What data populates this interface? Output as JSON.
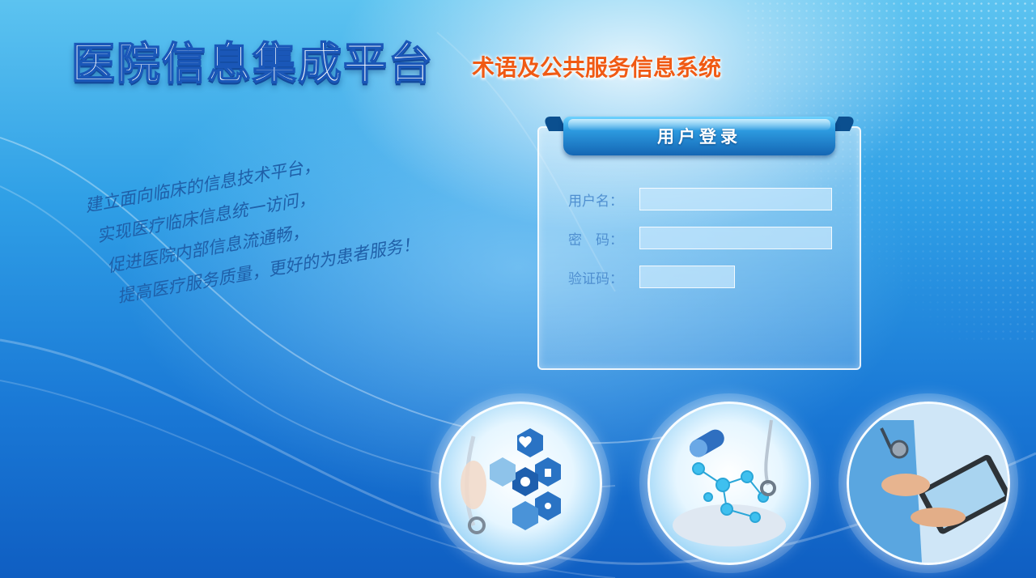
{
  "header": {
    "main_title": "医院信息集成平台",
    "sub_title": "术语及公共服务信息系统"
  },
  "slogan": {
    "lines": [
      "建立面向临床的信息技术平台，",
      "实现医疗临床信息统一访问，",
      "促进医院内部信息流通畅，",
      "提高医疗服务质量，更好的为患者服务！"
    ]
  },
  "login": {
    "title": "用户登录",
    "username_label": "用户名：",
    "password_label": "密　码：",
    "captcha_label": "验证码：",
    "username_value": "",
    "password_value": "",
    "captcha_value": ""
  },
  "images": [
    {
      "icon": "medical-hexagon-icons-illustration"
    },
    {
      "icon": "molecule-capsule-illustration"
    },
    {
      "icon": "doctor-tablet-illustration"
    }
  ],
  "colors": {
    "title_text": "#ffffff",
    "title_stroke": "#1a57b8",
    "subtitle": "#f05a14",
    "slogan": "#1f5fa8",
    "label": "#4f8fd0",
    "banner": "#1466b4"
  }
}
